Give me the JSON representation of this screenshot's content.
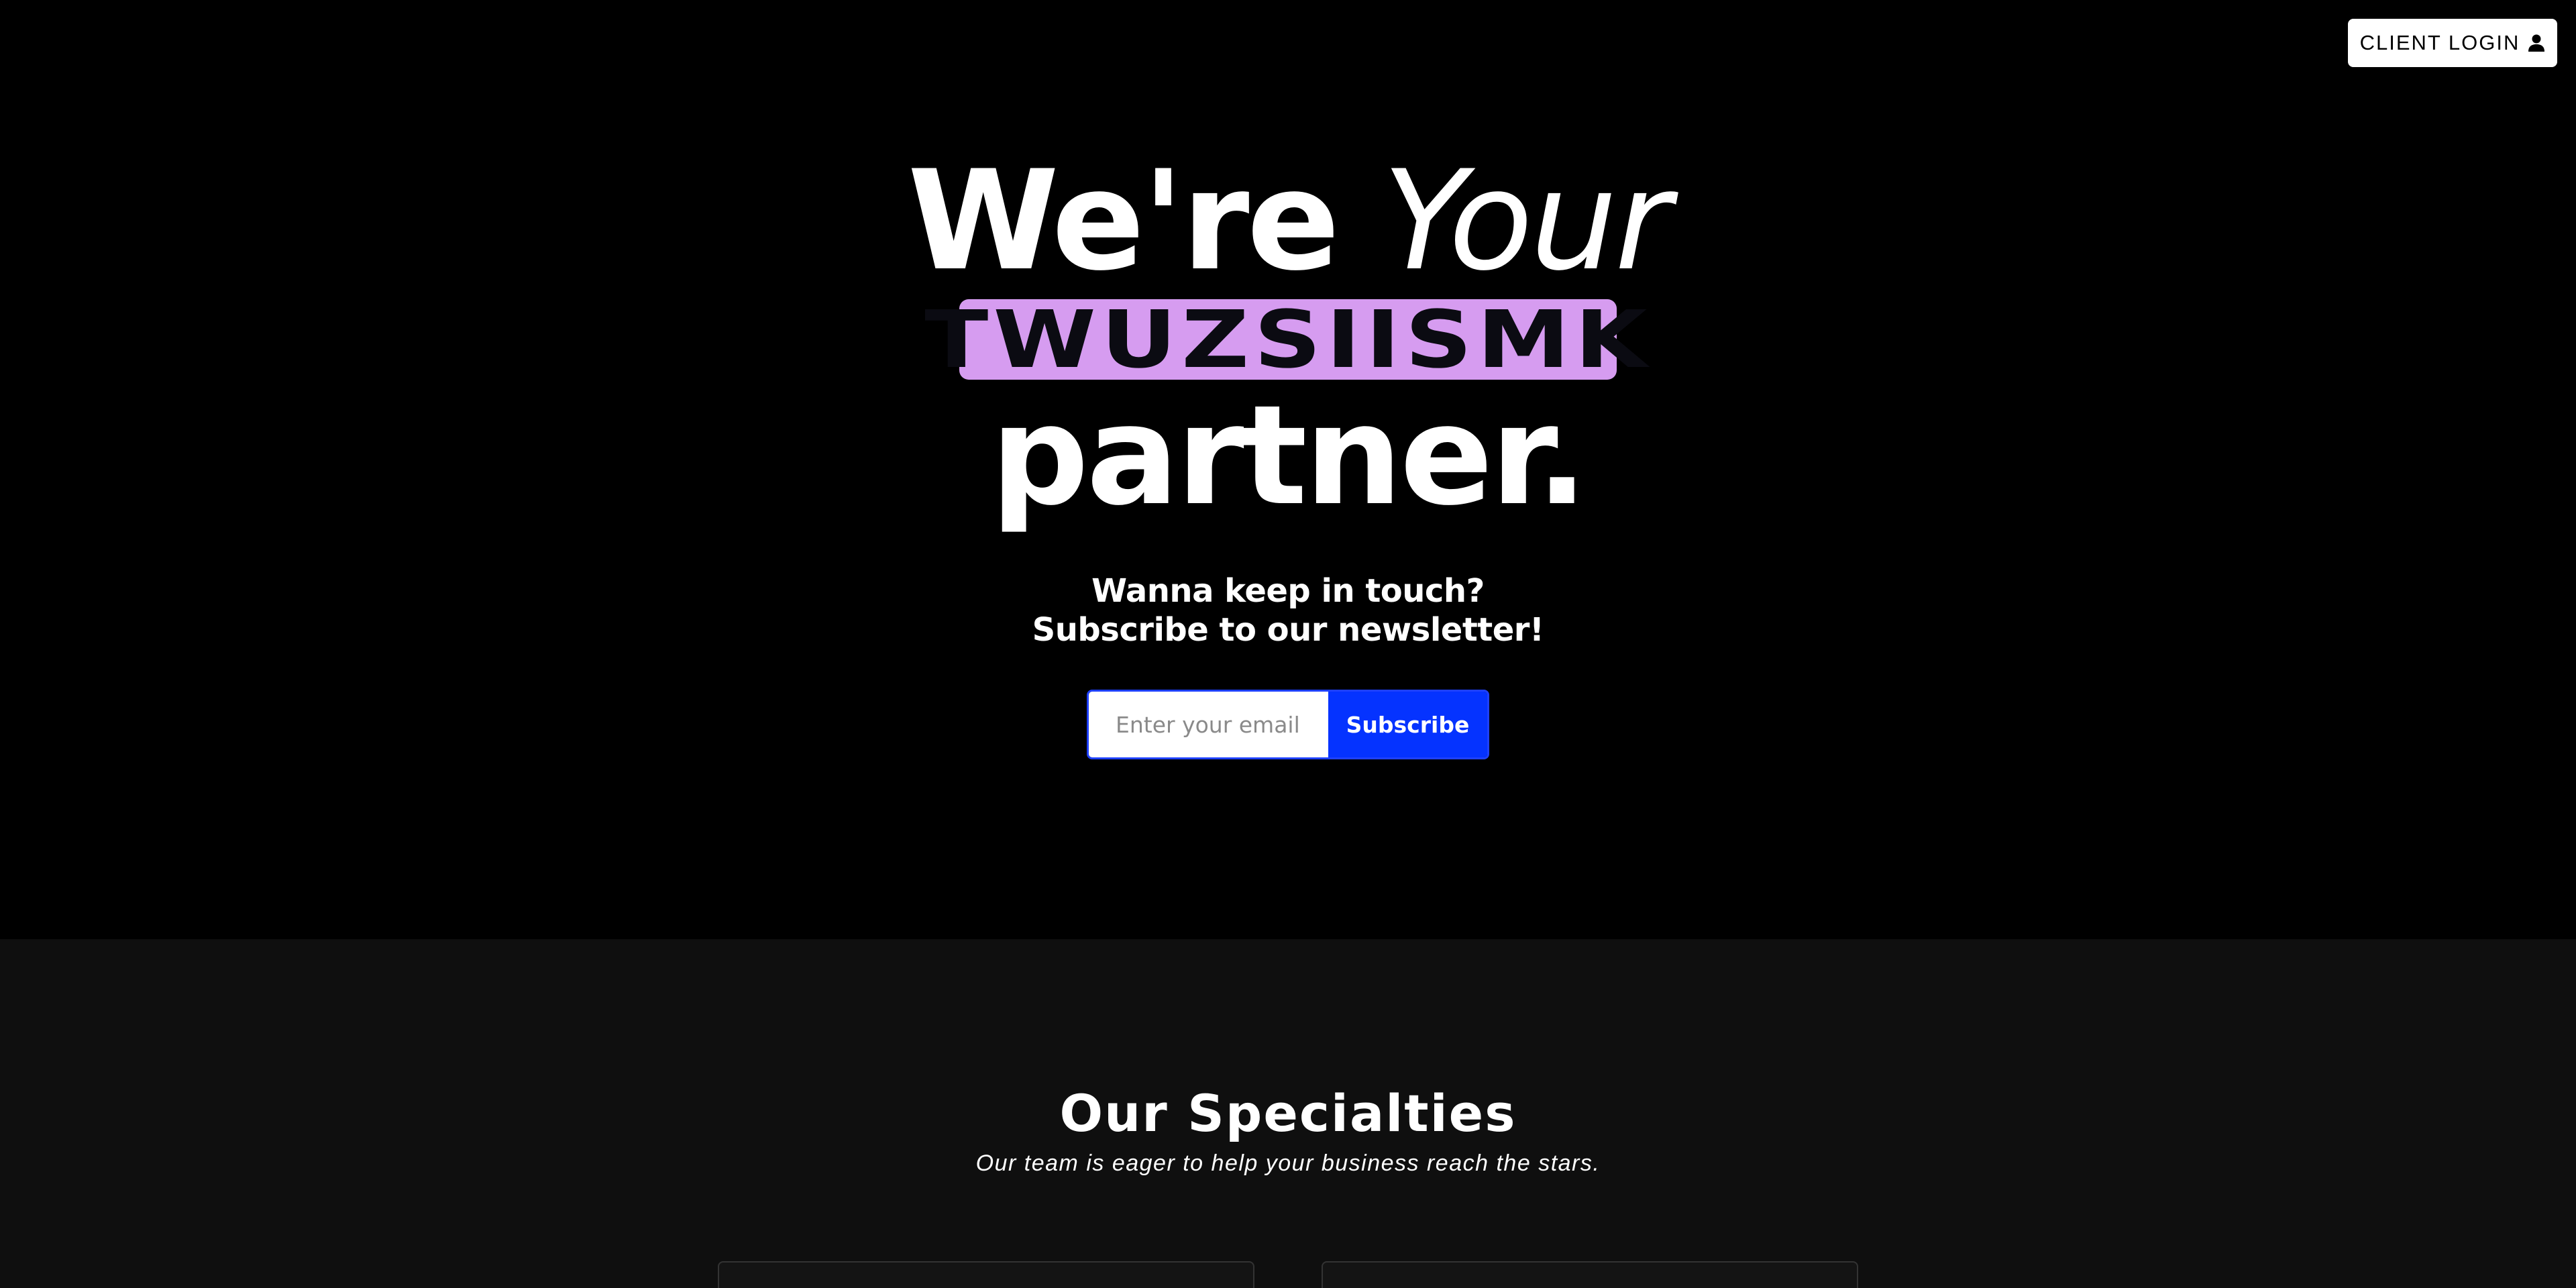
{
  "header": {
    "login_label": "CLIENT LOGIN",
    "login_icon": "user-icon"
  },
  "hero": {
    "headline_part1": "We're",
    "headline_part2": "Your",
    "brand": "TWUZSIISMK",
    "headline_part3": "partner.",
    "brand_pill_color": "#d69cf0",
    "newsletter_line1": "Wanna keep in touch?",
    "newsletter_line2": "Subscribe to our newsletter!",
    "email_placeholder": "Enter your email",
    "email_value": "",
    "subscribe_label": "Subscribe",
    "subscribe_color": "#0533ff"
  },
  "specialties": {
    "title": "Our Specialties",
    "subtitle": "Our team is eager to help your business reach the stars."
  },
  "colors": {
    "hero_background": "#000000",
    "section_background": "#0f0f0f",
    "text": "#ffffff"
  }
}
